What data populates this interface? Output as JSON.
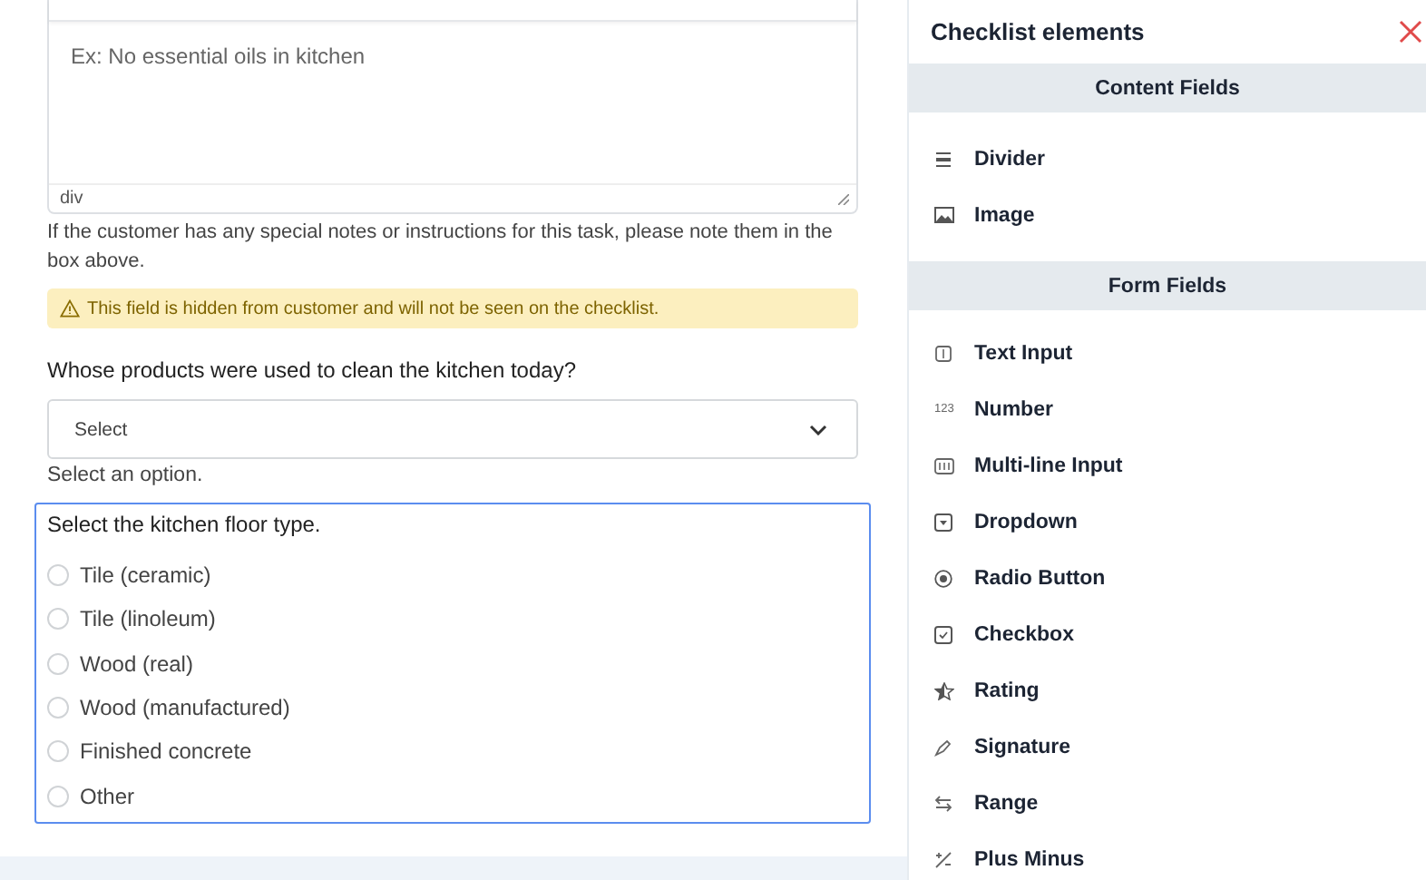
{
  "notes": {
    "placeholder": "Ex: No essential oils in kitchen",
    "path": "div",
    "help": "If the customer has any special notes or instructions for this task, please note them in the box above.",
    "warning": "This field is hidden from customer and will not be seen on the checklist."
  },
  "products": {
    "label": "Whose products were used to clean the kitchen today?",
    "value": "Select",
    "help": "Select an option."
  },
  "floor": {
    "label": "Select the kitchen floor type.",
    "focused": true,
    "options": [
      {
        "label": "Tile (ceramic)",
        "selected": false
      },
      {
        "label": "Tile (linoleum)",
        "selected": false
      },
      {
        "label": "Wood (real)",
        "selected": false
      },
      {
        "label": "Wood (manufactured)",
        "selected": false
      },
      {
        "label": "Finished concrete",
        "selected": false
      },
      {
        "label": "Other",
        "selected": false
      }
    ]
  },
  "panel": {
    "title": "Checklist elements",
    "sections": [
      {
        "title": "Content Fields",
        "items": [
          {
            "label": "Divider",
            "kind": "divider"
          },
          {
            "label": "Image",
            "kind": "image"
          }
        ]
      },
      {
        "title": "Form Fields",
        "items": [
          {
            "label": "Text Input",
            "kind": "text"
          },
          {
            "label": "Number",
            "kind": "number",
            "icon_text": "123"
          },
          {
            "label": "Multi-line Input",
            "kind": "multiline"
          },
          {
            "label": "Dropdown",
            "kind": "dropdown"
          },
          {
            "label": "Radio Button",
            "kind": "radio"
          },
          {
            "label": "Checkbox",
            "kind": "checkbox"
          },
          {
            "label": "Rating",
            "kind": "rating"
          },
          {
            "label": "Signature",
            "kind": "signature"
          },
          {
            "label": "Range",
            "kind": "range"
          },
          {
            "label": "Plus Minus",
            "kind": "plusminus"
          }
        ]
      }
    ]
  }
}
